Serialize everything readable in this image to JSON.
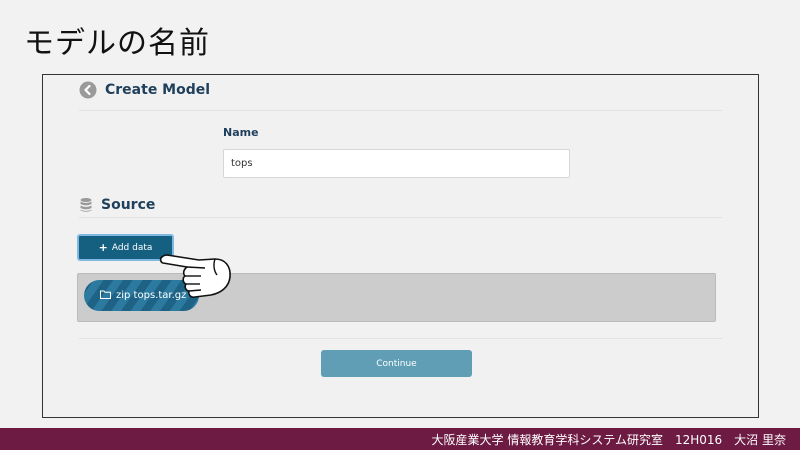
{
  "slide": {
    "title": "モデルの名前",
    "footer": "大阪産業大学 情報教育学科システム研究室　12H016　大沼 里奈"
  },
  "page": {
    "header_title": "Create Model",
    "name_label": "Name",
    "name_value": "tops",
    "source_title": "Source",
    "add_data_label": "Add data",
    "file_name": "zip tops.tar.gz",
    "continue_label": "Continue"
  },
  "icons": {
    "back": "back-circle-icon",
    "source": "database-icon",
    "plus": "plus-icon",
    "folder": "folder-icon",
    "pointer": "pointing-hand-icon"
  },
  "colors": {
    "primary": "#155f80",
    "continue": "#5f9eb4",
    "footer": "#6e1b44",
    "heading": "#1f3f5b"
  }
}
